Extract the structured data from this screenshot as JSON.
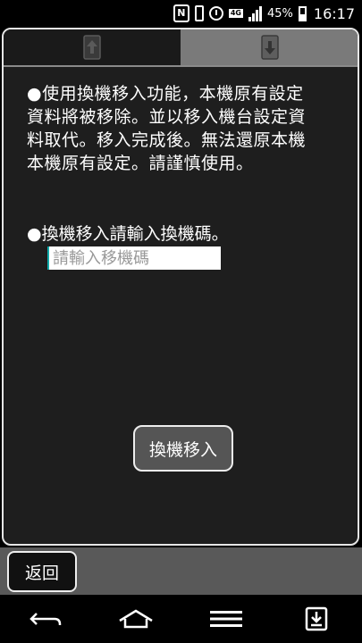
{
  "status_bar": {
    "nfc_label": "N",
    "network": "4G",
    "battery": "45%",
    "time": "16:17"
  },
  "tabs": [
    {
      "name": "export",
      "icon": "phone-upload-icon"
    },
    {
      "name": "import",
      "icon": "phone-download-icon",
      "selected": true
    }
  ],
  "content": {
    "message_lines": [
      "●使用換機移入功能，本機原有設定",
      "資料將被移除。並以移入機台設定資",
      "料取代。移入完成後。無法還原本機",
      "本機原有設定。請謹慎使用。"
    ],
    "prompt": "●換機移入請輸入換機碼。",
    "code_input": {
      "value": "",
      "placeholder": "請輸入移機碼"
    },
    "primary_button": "換機移入"
  },
  "bottom": {
    "back_button": "返回"
  },
  "nav": [
    "back-icon",
    "home-icon",
    "menu-icon",
    "notifications-icon"
  ],
  "colors": {
    "panel_bg": "#1e1e1e",
    "selected_tab": "#7a7a7a",
    "bottom_strip": "#595959",
    "button_bg": "#555555"
  }
}
